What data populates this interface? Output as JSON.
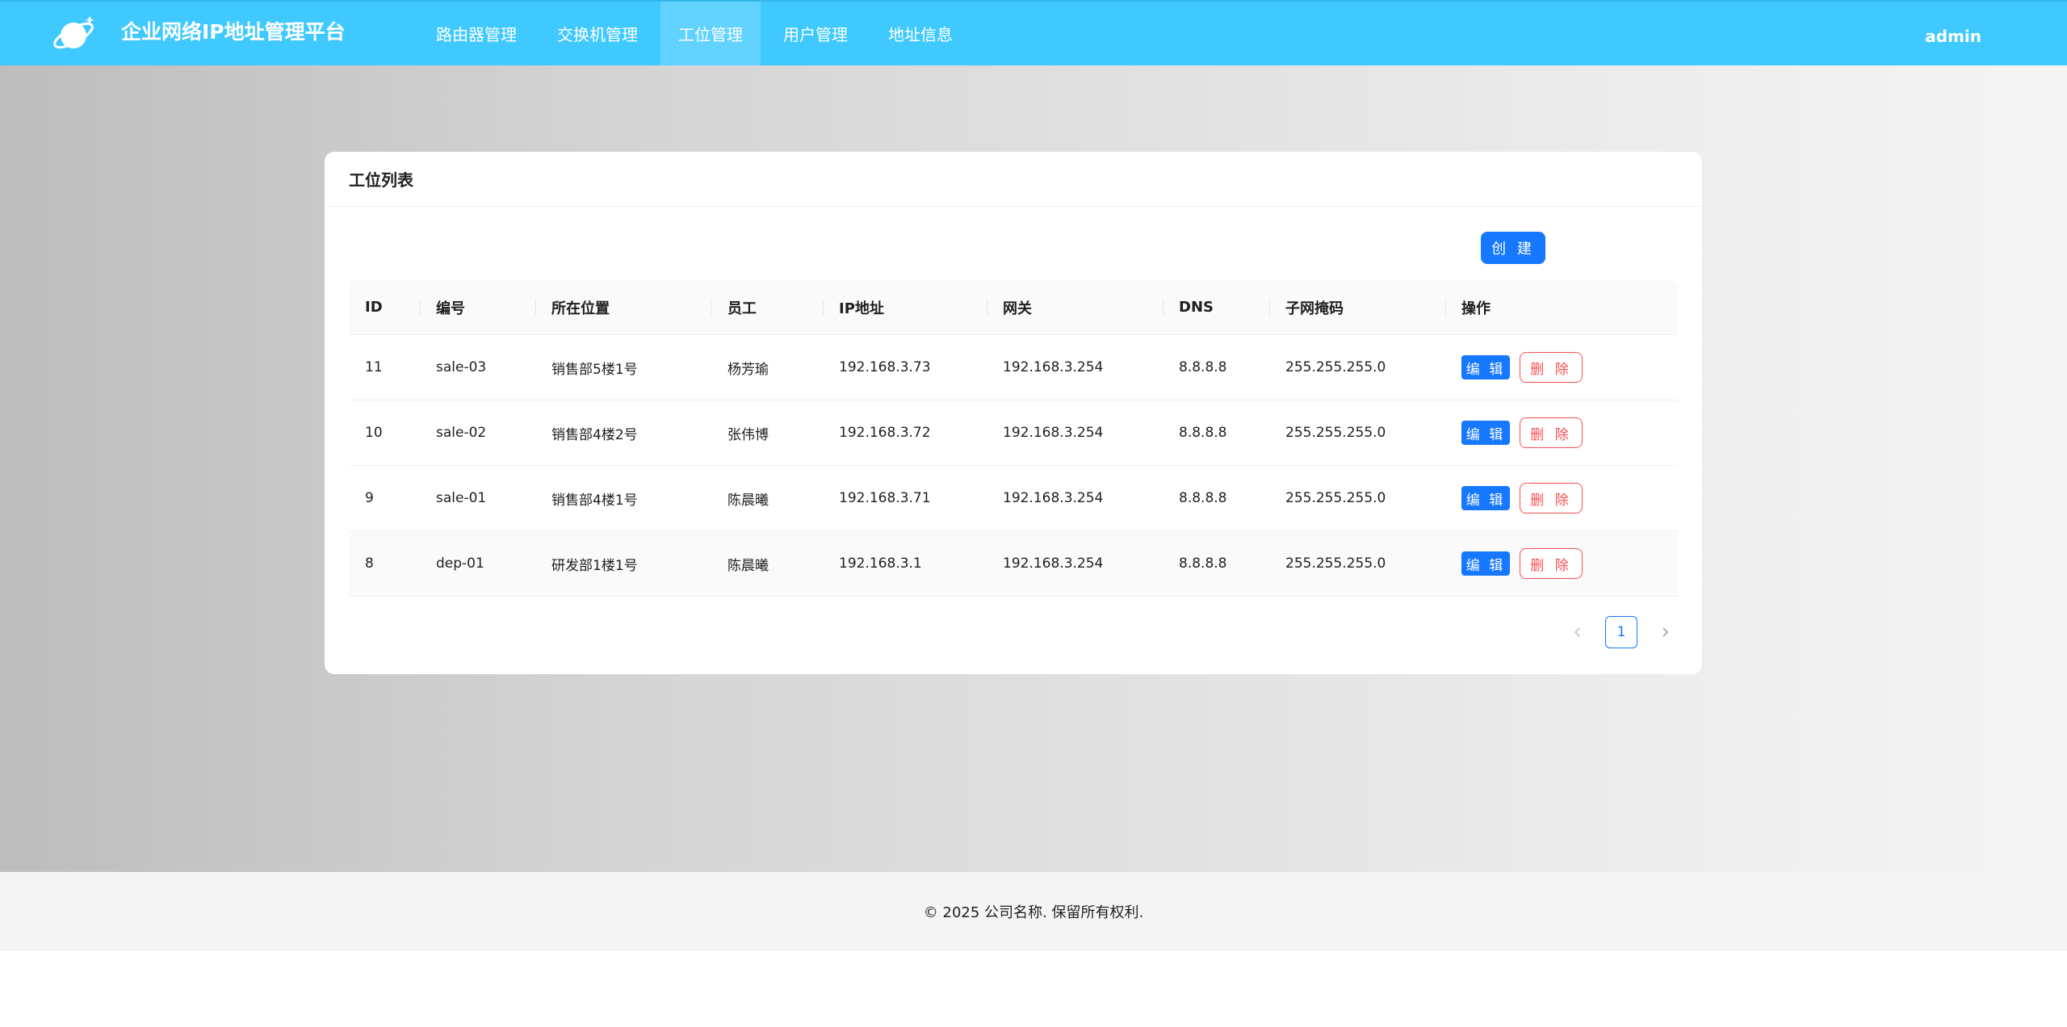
{
  "app": {
    "title": "企业网络IP地址管理平台",
    "user": "admin",
    "accent_color": "#40c9ff",
    "primary_color": "#1677ff",
    "danger_color": "#ff4d4f"
  },
  "nav": {
    "items": [
      {
        "label": "路由器管理",
        "active": false
      },
      {
        "label": "交换机管理",
        "active": false
      },
      {
        "label": "工位管理",
        "active": true
      },
      {
        "label": "用户管理",
        "active": false
      },
      {
        "label": "地址信息",
        "active": false
      }
    ]
  },
  "card": {
    "title": "工位列表",
    "create_label": "创 建"
  },
  "table": {
    "columns": [
      "ID",
      "编号",
      "所在位置",
      "员工",
      "IP地址",
      "网关",
      "DNS",
      "子网掩码",
      "操作"
    ],
    "edit_label": "编 辑",
    "delete_label": "删 除",
    "rows": [
      {
        "id": "11",
        "code": "sale-03",
        "location": "销售部5楼1号",
        "employee": "杨芳瑜",
        "ip": "192.168.3.73",
        "gateway": "192.168.3.254",
        "dns": "8.8.8.8",
        "mask": "255.255.255.0"
      },
      {
        "id": "10",
        "code": "sale-02",
        "location": "销售部4楼2号",
        "employee": "张伟博",
        "ip": "192.168.3.72",
        "gateway": "192.168.3.254",
        "dns": "8.8.8.8",
        "mask": "255.255.255.0"
      },
      {
        "id": "9",
        "code": "sale-01",
        "location": "销售部4楼1号",
        "employee": "陈晨曦",
        "ip": "192.168.3.71",
        "gateway": "192.168.3.254",
        "dns": "8.8.8.8",
        "mask": "255.255.255.0"
      },
      {
        "id": "8",
        "code": "dep-01",
        "location": "研发部1楼1号",
        "employee": "陈晨曦",
        "ip": "192.168.3.1",
        "gateway": "192.168.3.254",
        "dns": "8.8.8.8",
        "mask": "255.255.255.0"
      }
    ]
  },
  "pagination": {
    "current_page": "1",
    "prev_icon": "chevron-left-icon",
    "next_icon": "chevron-right-icon"
  },
  "footer": {
    "copyright": "© 2025 公司名称. 保留所有权利."
  }
}
